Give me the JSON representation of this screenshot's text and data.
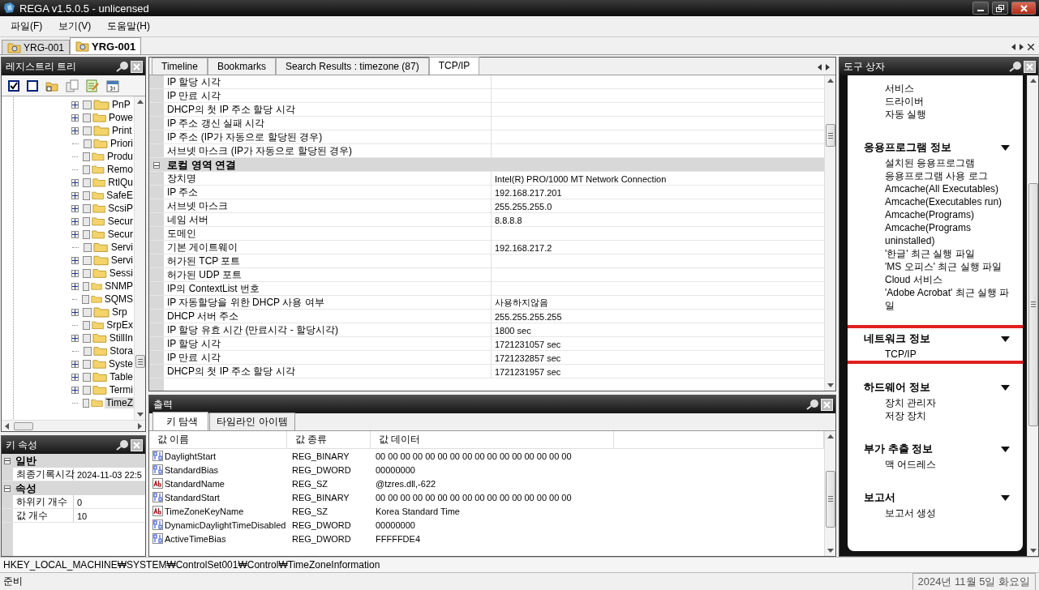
{
  "window": {
    "title": "REGA v1.5.0.5 - unlicensed"
  },
  "menu": [
    "파일(F)",
    "보기(V)",
    "도움말(H)"
  ],
  "doc_tabs": [
    {
      "label": "YRG-001",
      "selected": false
    },
    {
      "label": "YRG-001",
      "selected": true
    }
  ],
  "registry_tree": {
    "title": "레지스트리 트리",
    "items": [
      {
        "name": "PnP",
        "expandable": true,
        "checked": false,
        "selected": false
      },
      {
        "name": "Powe",
        "expandable": true,
        "checked": false,
        "selected": false
      },
      {
        "name": "Print",
        "expandable": true,
        "checked": false,
        "selected": false
      },
      {
        "name": "Priori",
        "expandable": false,
        "checked": false,
        "selected": false
      },
      {
        "name": "Produ",
        "expandable": false,
        "checked": false,
        "selected": false
      },
      {
        "name": "Remo",
        "expandable": false,
        "checked": false,
        "selected": false
      },
      {
        "name": "RtlQu",
        "expandable": true,
        "checked": false,
        "selected": false
      },
      {
        "name": "SafeE",
        "expandable": true,
        "checked": false,
        "selected": false
      },
      {
        "name": "ScsiP",
        "expandable": true,
        "checked": false,
        "selected": false
      },
      {
        "name": "Secur",
        "expandable": true,
        "checked": false,
        "selected": false
      },
      {
        "name": "Secur",
        "expandable": true,
        "checked": false,
        "selected": false
      },
      {
        "name": "Servi",
        "expandable": false,
        "checked": false,
        "selected": false
      },
      {
        "name": "Servi",
        "expandable": true,
        "checked": false,
        "selected": false
      },
      {
        "name": "Sessi",
        "expandable": true,
        "checked": false,
        "selected": false
      },
      {
        "name": "SNMP",
        "expandable": true,
        "checked": false,
        "selected": false
      },
      {
        "name": "SQMS",
        "expandable": false,
        "checked": false,
        "selected": false
      },
      {
        "name": "Srp",
        "expandable": true,
        "checked": false,
        "selected": false
      },
      {
        "name": "SrpEx",
        "expandable": false,
        "checked": false,
        "selected": false
      },
      {
        "name": "StillIn",
        "expandable": true,
        "checked": false,
        "selected": false
      },
      {
        "name": "Stora",
        "expandable": false,
        "checked": false,
        "selected": false
      },
      {
        "name": "Syste",
        "expandable": true,
        "checked": false,
        "selected": false
      },
      {
        "name": "Table",
        "expandable": true,
        "checked": false,
        "selected": false
      },
      {
        "name": "Termi",
        "expandable": true,
        "checked": false,
        "selected": false
      },
      {
        "name": "TimeZ",
        "expandable": false,
        "checked": false,
        "selected": true
      }
    ]
  },
  "key_properties": {
    "title": "키 속성",
    "groups": [
      {
        "name": "일반",
        "expanded": true,
        "rows": [
          {
            "name": "최종기록시각",
            "value": "2024-11-03  22:5"
          }
        ]
      },
      {
        "name": "속성",
        "expanded": true,
        "rows": [
          {
            "name": "하위키 개수",
            "value": "0"
          },
          {
            "name": "값 개수",
            "value": "10"
          }
        ]
      }
    ]
  },
  "main_tabs": [
    {
      "label": "Timeline",
      "selected": false
    },
    {
      "label": "Bookmarks",
      "selected": false
    },
    {
      "label": "Search Results : timezone (87)",
      "selected": false
    },
    {
      "label": "TCP/IP",
      "selected": true
    }
  ],
  "tcpip_rows": [
    {
      "kind": "row",
      "name": "IP 할당 시각",
      "value": ""
    },
    {
      "kind": "row",
      "name": "IP 만료 시각",
      "value": ""
    },
    {
      "kind": "row",
      "name": "DHCP의 첫 IP 주소 할당 시각",
      "value": ""
    },
    {
      "kind": "row",
      "name": "IP 주소 갱신 실패 시각",
      "value": ""
    },
    {
      "kind": "row",
      "name": "IP 주소 (IP가 자동으로 할당된 경우)",
      "value": ""
    },
    {
      "kind": "row",
      "name": "서브넷 마스크 (IP가 자동으로 할당된 경우)",
      "value": ""
    },
    {
      "kind": "group",
      "name": "로컬 영역 연결",
      "expanded": true
    },
    {
      "kind": "row",
      "name": "장치명",
      "value": "Intel(R) PRO/1000 MT Network Connection"
    },
    {
      "kind": "row",
      "name": "IP 주소",
      "value": "192.168.217.201"
    },
    {
      "kind": "row",
      "name": "서브넷 마스크",
      "value": "255.255.255.0"
    },
    {
      "kind": "row",
      "name": "네임 서버",
      "value": "8.8.8.8"
    },
    {
      "kind": "row",
      "name": "도메인",
      "value": ""
    },
    {
      "kind": "row",
      "name": "기본 게이트웨이",
      "value": "192.168.217.2"
    },
    {
      "kind": "row",
      "name": "허가된 TCP 포트",
      "value": ""
    },
    {
      "kind": "row",
      "name": "허가된 UDP 포트",
      "value": ""
    },
    {
      "kind": "row",
      "name": "IP의 ContextList 번호",
      "value": ""
    },
    {
      "kind": "row",
      "name": "IP 자동할당을 위한 DHCP 사용 여부",
      "value": "사용하지않음"
    },
    {
      "kind": "row",
      "name": "DHCP 서버 주소",
      "value": "255.255.255.255"
    },
    {
      "kind": "row",
      "name": "IP 할당 유효 시간 (만료시각 - 할당시각)",
      "value": "1800 sec"
    },
    {
      "kind": "row",
      "name": "IP 할당 시각",
      "value": "1721231057 sec"
    },
    {
      "kind": "row",
      "name": "IP 만료 시각",
      "value": "1721232857 sec"
    },
    {
      "kind": "row",
      "name": "DHCP의 첫 IP 주소 할당 시각",
      "value": "1721231957 sec"
    }
  ],
  "output": {
    "title": "출력",
    "tabs": [
      {
        "label": "키 탐색",
        "selected": true
      },
      {
        "label": "타임라인 아이템",
        "selected": false
      }
    ],
    "columns": [
      "값 이름",
      "값 종류",
      "값 데이터"
    ],
    "rows": [
      {
        "kind": "binary",
        "name": "DaylightStart",
        "type": "REG_BINARY",
        "data": "00 00 00 00 00 00 00 00 00 00 00 00 00 00 00 00"
      },
      {
        "kind": "binary",
        "name": "StandardBias",
        "type": "REG_DWORD",
        "data": "00000000"
      },
      {
        "kind": "string",
        "name": "StandardName",
        "type": "REG_SZ",
        "data": "@tzres.dll,-622"
      },
      {
        "kind": "binary",
        "name": "StandardStart",
        "type": "REG_BINARY",
        "data": "00 00 00 00 00 00 00 00 00 00 00 00 00 00 00 00"
      },
      {
        "kind": "string",
        "name": "TimeZoneKeyName",
        "type": "REG_SZ",
        "data": "Korea Standard Time"
      },
      {
        "kind": "binary",
        "name": "DynamicDaylightTimeDisabled",
        "type": "REG_DWORD",
        "data": "00000000"
      },
      {
        "kind": "binary",
        "name": "ActiveTimeBias",
        "type": "REG_DWORD",
        "data": "FFFFFDE4"
      }
    ]
  },
  "toolbox": {
    "title": "도구 상자",
    "groups": [
      {
        "highlighted": false,
        "items": [
          "서비스",
          "드라이버",
          "자동 실행"
        ]
      },
      {
        "heading": "응용프로그램 정보",
        "highlighted": false,
        "items": [
          "설치된 응용프로그램",
          "응용프로그램 사용 로그",
          "Amcache(All Executables)",
          "Amcache(Executables run)",
          "Amcache(Programs)",
          "Amcache(Programs uninstalled)",
          "'한글' 최근 실행 파일",
          "'MS 오피스' 최근 실행 파일",
          "Cloud 서비스",
          "'Adobe Acrobat' 최근 실행 파일"
        ]
      },
      {
        "heading": "네트워크 정보",
        "highlighted": true,
        "items": [
          "TCP/IP"
        ]
      },
      {
        "heading": "하드웨어 정보",
        "highlighted": false,
        "items": [
          "장치 관리자",
          "저장 장치"
        ]
      },
      {
        "heading": "부가 추출 정보",
        "highlighted": false,
        "items": [
          "맥 어드레스"
        ]
      },
      {
        "heading": "보고서",
        "highlighted": false,
        "items": [
          "보고서 생성"
        ]
      }
    ]
  },
  "path_bar": "HKEY_LOCAL_MACHINE₩SYSTEM₩ControlSet001₩Control₩TimeZoneInformation",
  "status_bar": {
    "text": "준비",
    "date": "2024년 11월 5일 화요일"
  }
}
